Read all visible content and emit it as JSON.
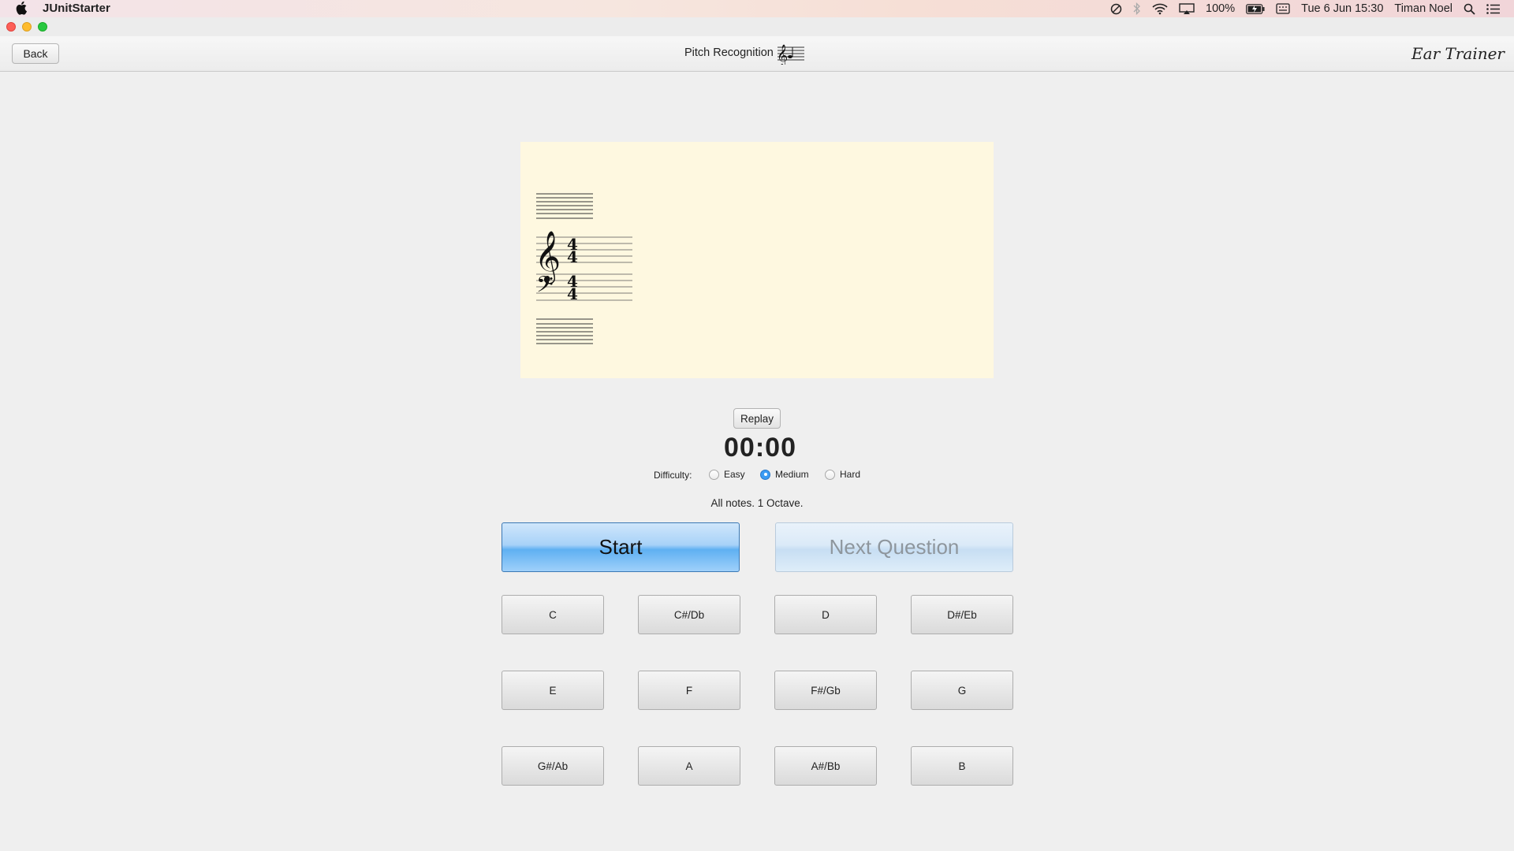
{
  "menubar": {
    "app_name": "JUnitStarter",
    "battery": "100%",
    "datetime": "Tue 6 Jun  15:30",
    "user": "Timan Noel",
    "icons": [
      "do-not-disturb-icon",
      "bluetooth-icon",
      "wifi-icon",
      "airplay-icon",
      "battery-icon",
      "keyboard-icon",
      "spotlight-icon",
      "notification-center-icon"
    ]
  },
  "toolbar": {
    "back_label": "Back",
    "title": "Pitch Recognition",
    "brand": "Ear Trainer"
  },
  "staff": {
    "treble_time_top": "4",
    "treble_time_bottom": "4",
    "bass_time_top": "4",
    "bass_time_bottom": "4"
  },
  "controls": {
    "replay_label": "Replay",
    "timer": "00:00",
    "difficulty_label": "Difficulty:",
    "difficulty_options": [
      {
        "label": "Easy",
        "selected": false
      },
      {
        "label": "Medium",
        "selected": true
      },
      {
        "label": "Hard",
        "selected": false
      }
    ],
    "description": "All notes. 1 Octave.",
    "start_label": "Start",
    "next_label": "Next Question"
  },
  "notes": {
    "row1": [
      "C",
      "C#/Db",
      "D",
      "D#/Eb"
    ],
    "row2": [
      "E",
      "F",
      "F#/Gb",
      "G"
    ],
    "row3": [
      "G#/Ab",
      "A",
      "A#/Bb",
      "B"
    ]
  },
  "colors": {
    "staff_bg": "#fef8e0",
    "start_accent": "#5fb0f2",
    "radio_selected": "#3b9bf3"
  }
}
